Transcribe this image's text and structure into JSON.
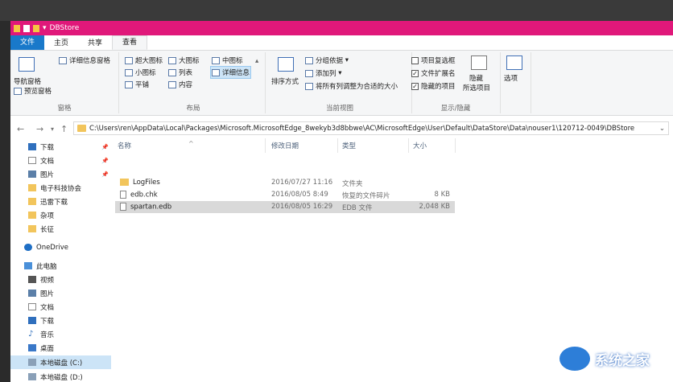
{
  "window": {
    "title": "DBStore"
  },
  "tabs": [
    {
      "label": "文件"
    },
    {
      "label": "主页"
    },
    {
      "label": "共享"
    },
    {
      "label": "查看"
    }
  ],
  "ribbon": {
    "pane": {
      "nav_pane": "导航窗格",
      "preview_pane": "预览窗格",
      "details_pane": "详细信息窗格",
      "group_label": "窗格"
    },
    "layout": {
      "xlarge": "超大图标",
      "large": "大图标",
      "medium": "中图标",
      "small": "小图标",
      "list": "列表",
      "details": "详细信息",
      "tiles": "平铺",
      "content": "内容",
      "group_label": "布局"
    },
    "current_view": {
      "sort": "排序方式",
      "group_by": "分组依据",
      "add_column": "添加列",
      "fit_columns": "将所有列调整为合适的大小",
      "group_label": "当前视图"
    },
    "show_hide": {
      "item_checkbox": "项目复选框",
      "extensions": "文件扩展名",
      "hidden_items": "隐藏的项目",
      "hide": "隐藏",
      "selected_items": "所选项目",
      "group_label": "显示/隐藏"
    },
    "options": {
      "label": "选项"
    }
  },
  "address": {
    "path": "C:\\Users\\ren\\AppData\\Local\\Packages\\Microsoft.MicrosoftEdge_8wekyb3d8bbwe\\AC\\MicrosoftEdge\\User\\Default\\DataStore\\Data\\nouser1\\120712-0049\\DBStore"
  },
  "navpane": {
    "quick": [
      {
        "label": "下载",
        "pinned": true
      },
      {
        "label": "文档",
        "pinned": true
      },
      {
        "label": "图片",
        "pinned": true
      },
      {
        "label": "电子科技协会",
        "pinned": false
      },
      {
        "label": "迅雷下载",
        "pinned": false
      },
      {
        "label": "杂项",
        "pinned": false
      },
      {
        "label": "长征",
        "pinned": false
      }
    ],
    "onedrive": "OneDrive",
    "thispc": "此电脑",
    "pc_items": [
      {
        "label": "视频"
      },
      {
        "label": "图片"
      },
      {
        "label": "文档"
      },
      {
        "label": "下载"
      },
      {
        "label": "音乐"
      },
      {
        "label": "桌面"
      },
      {
        "label": "本地磁盘 (C:)"
      },
      {
        "label": "本地磁盘 (D:)"
      }
    ]
  },
  "columns": {
    "name": "名称",
    "date": "修改日期",
    "type": "类型",
    "size": "大小"
  },
  "files": [
    {
      "name": "LogFiles",
      "date": "2016/07/27 11:16",
      "type": "文件夹",
      "size": "",
      "kind": "folder",
      "selected": false
    },
    {
      "name": "edb.chk",
      "date": "2016/08/05 8:49",
      "type": "恢复的文件碎片",
      "size": "8 KB",
      "kind": "file",
      "selected": false
    },
    {
      "name": "spartan.edb",
      "date": "2016/08/05 16:29",
      "type": "EDB 文件",
      "size": "2,048 KB",
      "kind": "file",
      "selected": true
    }
  ],
  "watermark": {
    "text": "系统之家"
  }
}
